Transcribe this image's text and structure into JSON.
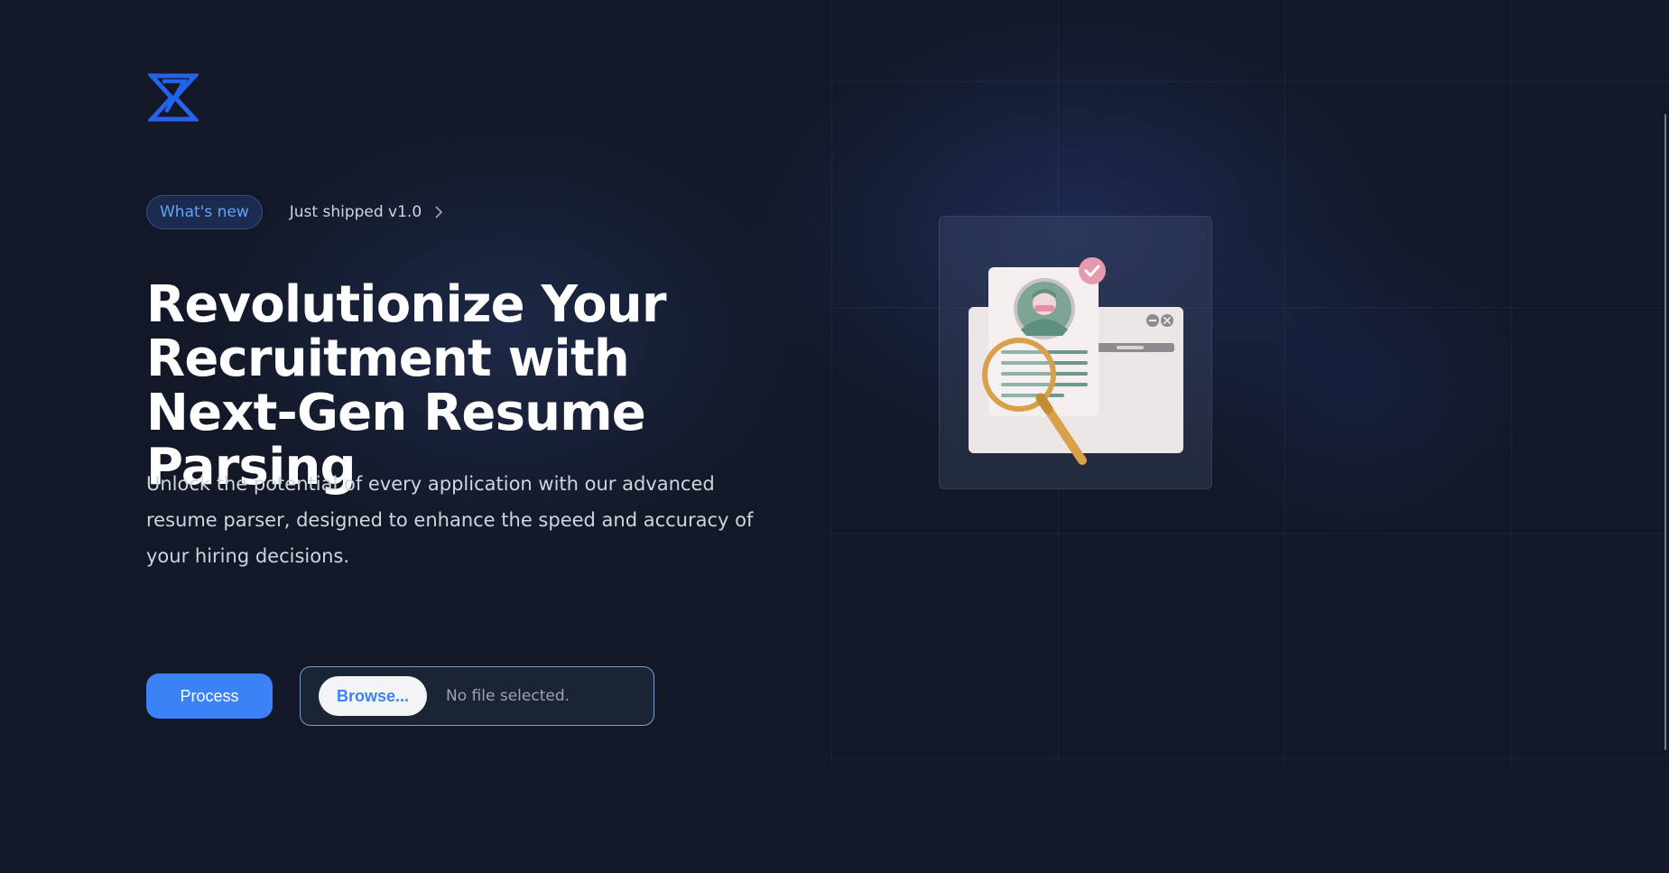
{
  "announcement": {
    "badge_label": "What's new",
    "shipped_label": "Just shipped v1.0",
    "chevron_icon": "chevron-right-icon"
  },
  "hero": {
    "title": "Revolutionize Your Recruitment with Next-Gen Resume Parsing",
    "description": "Unlock the potential of every application with our advanced resume parser, designed to enhance the speed and accuracy of your hiring decisions."
  },
  "actions": {
    "process_label": "Process",
    "browse_label": "Browse...",
    "file_status": "No file selected."
  },
  "icons": {
    "logo": "hourglass-logo-icon",
    "illustration": "resume-magnifier-illustration"
  },
  "colors": {
    "accent": "#3b82f6",
    "badge_text": "#60a5fa",
    "background": "#111827"
  }
}
